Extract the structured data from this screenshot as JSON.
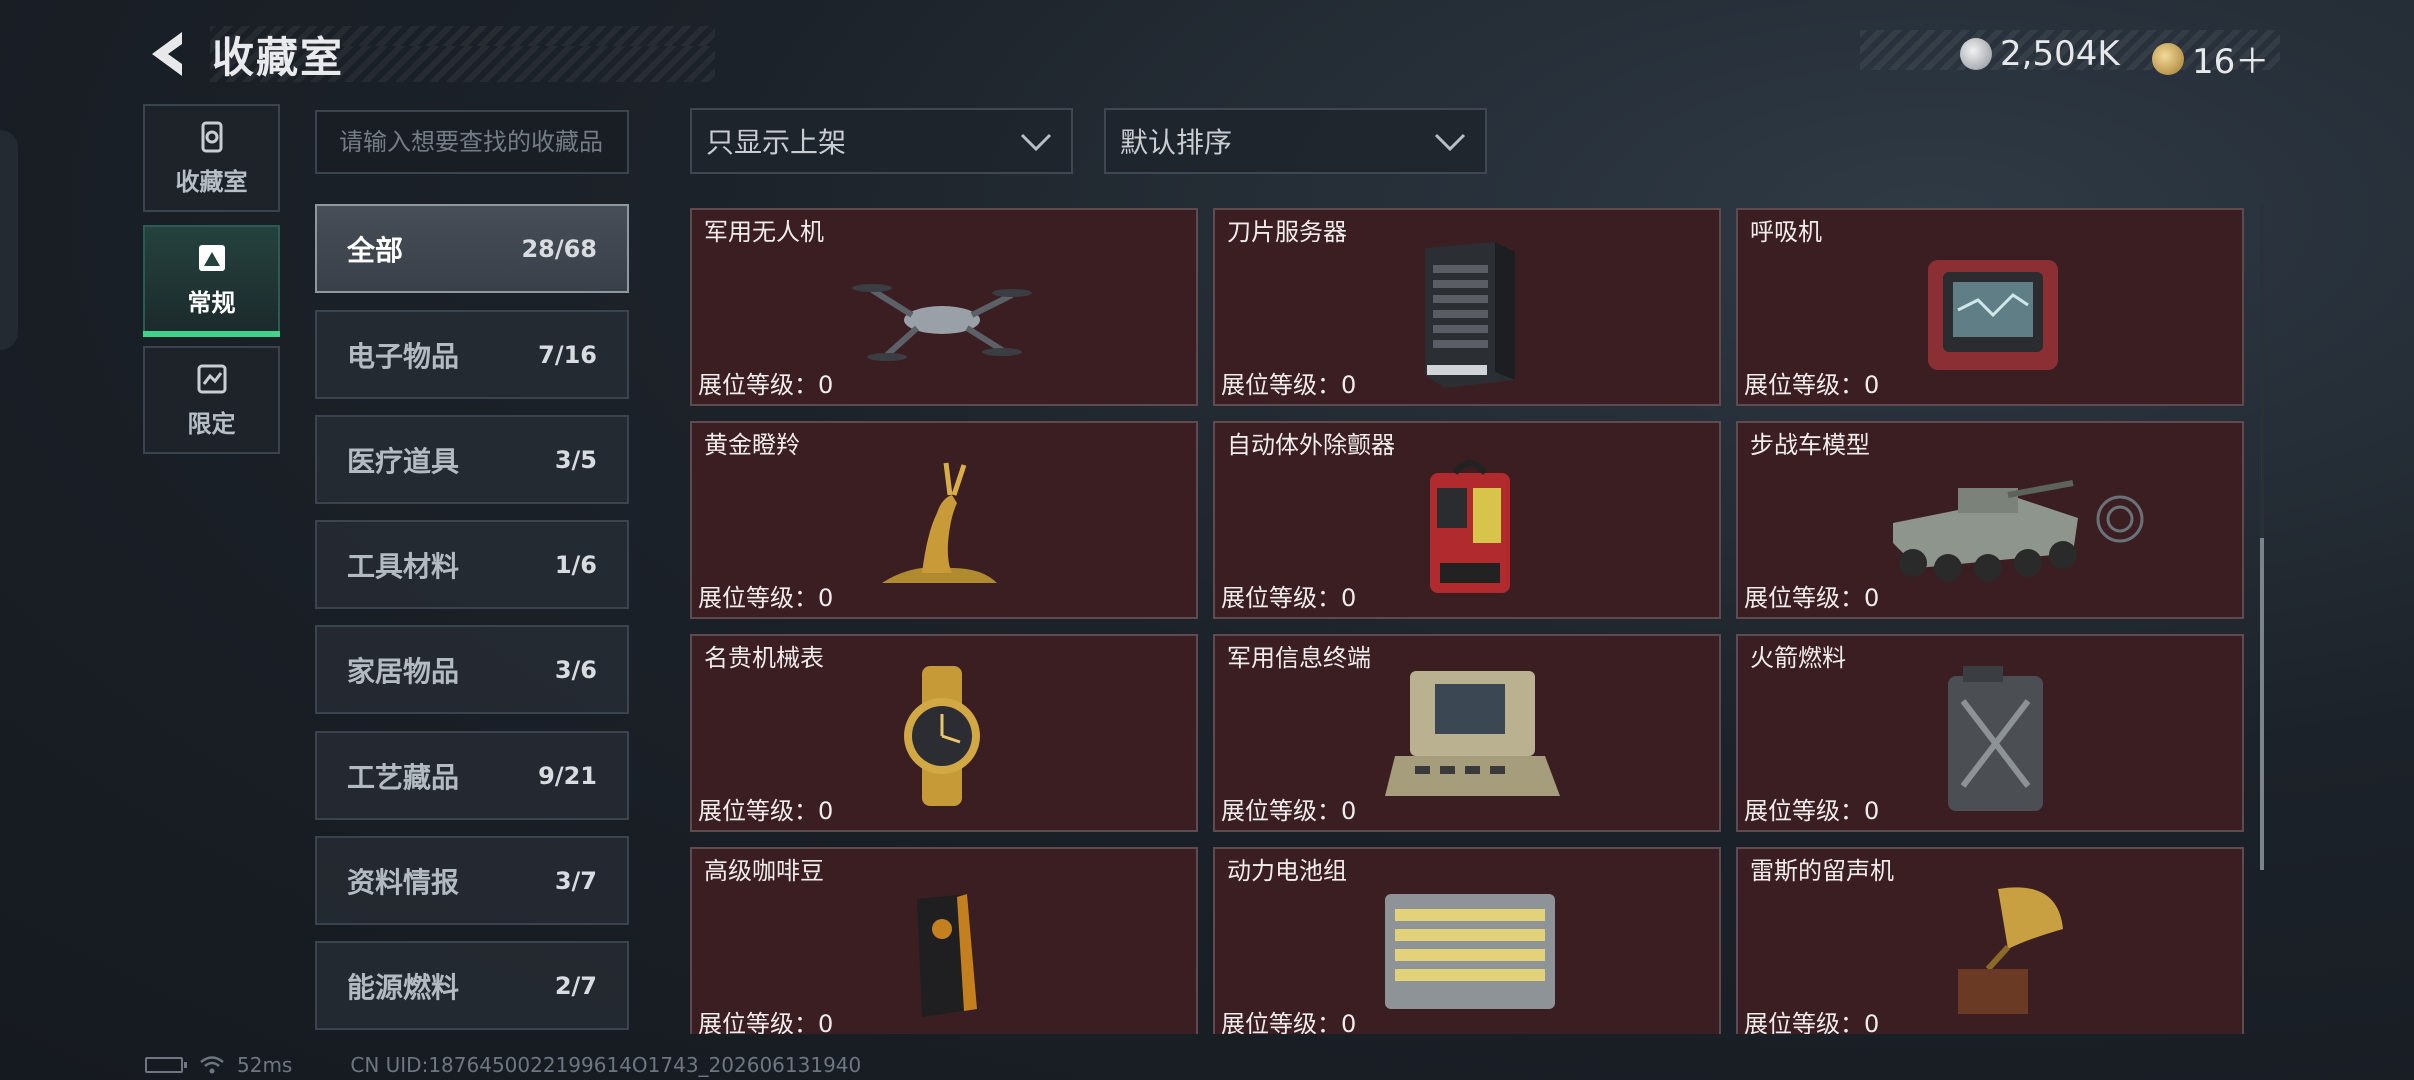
{
  "header": {
    "title": "收藏室",
    "currencies": [
      {
        "icon": "silver-coin-icon",
        "value": "2,504K"
      },
      {
        "icon": "gold-coin-icon",
        "value": "16＋"
      }
    ]
  },
  "nav": [
    {
      "label": "收藏室",
      "icon": "collection-room-icon",
      "active": false
    },
    {
      "label": "常规",
      "icon": "regular-icon",
      "active": true
    },
    {
      "label": "限定",
      "icon": "limited-icon",
      "active": false
    }
  ],
  "search": {
    "placeholder": "请输入想要查找的收藏品"
  },
  "filters": {
    "display": "只显示上架",
    "sort": "默认排序"
  },
  "categories": [
    {
      "label": "全部",
      "count": "28/68",
      "active": true
    },
    {
      "label": "电子物品",
      "count": "7/16"
    },
    {
      "label": "医疗道具",
      "count": "3/5"
    },
    {
      "label": "工具材料",
      "count": "1/6"
    },
    {
      "label": "家居物品",
      "count": "3/6"
    },
    {
      "label": "工艺藏品",
      "count": "9/21"
    },
    {
      "label": "资料情报",
      "count": "3/7"
    },
    {
      "label": "能源燃料",
      "count": "2/7"
    }
  ],
  "items": [
    {
      "name": "军用无人机",
      "level": "展位等级：0",
      "icon": "drone-icon"
    },
    {
      "name": "刀片服务器",
      "level": "展位等级：0",
      "icon": "blade-server-icon"
    },
    {
      "name": "呼吸机",
      "level": "展位等级：0",
      "icon": "ventilator-icon"
    },
    {
      "name": "黄金瞪羚",
      "level": "展位等级：0",
      "icon": "golden-gazelle-icon"
    },
    {
      "name": "自动体外除颤器",
      "level": "展位等级：0",
      "icon": "defibrillator-icon"
    },
    {
      "name": "步战车模型",
      "level": "展位等级：0",
      "icon": "ifv-model-icon"
    },
    {
      "name": "名贵机械表",
      "level": "展位等级：0",
      "icon": "luxury-watch-icon"
    },
    {
      "name": "军用信息终端",
      "level": "展位等级：0",
      "icon": "military-terminal-icon"
    },
    {
      "name": "火箭燃料",
      "level": "展位等级：0",
      "icon": "rocket-fuel-icon"
    },
    {
      "name": "高级咖啡豆",
      "level": "展位等级：0",
      "icon": "coffee-beans-icon"
    },
    {
      "name": "动力电池组",
      "level": "展位等级：0",
      "icon": "battery-pack-icon"
    },
    {
      "name": "雷斯的留声机",
      "level": "展位等级：0",
      "icon": "gramophone-icon"
    }
  ],
  "footer": {
    "ping": "52ms",
    "uid": "CN UID:1876450022199614O1743_202606131940"
  }
}
